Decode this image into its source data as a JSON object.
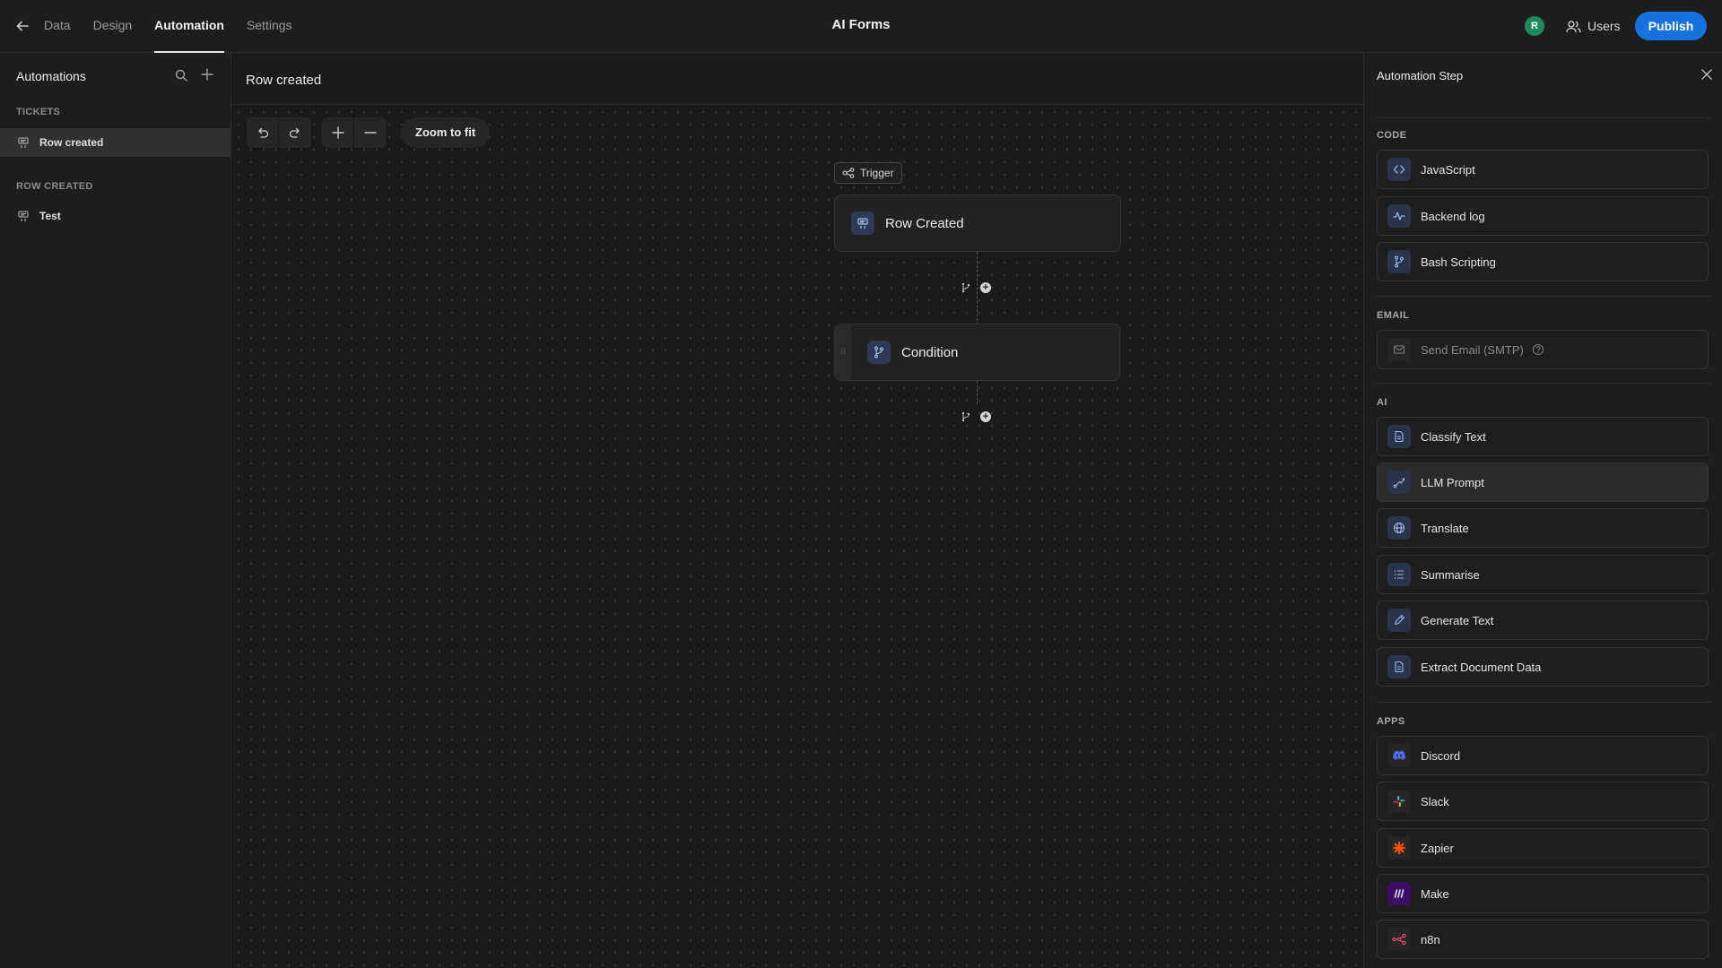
{
  "header": {
    "tabs": [
      {
        "label": "Data"
      },
      {
        "label": "Design"
      },
      {
        "label": "Automation"
      },
      {
        "label": "Settings"
      }
    ],
    "active_tab": "Automation",
    "app_title": "AI Forms",
    "avatar_initial": "R",
    "users_label": "Users",
    "publish_label": "Publish"
  },
  "sidebar": {
    "title": "Automations",
    "sections": [
      {
        "heading": "TICKETS",
        "items": [
          {
            "label": "Row created",
            "selected": true
          }
        ]
      },
      {
        "heading": "ROW CREATED",
        "items": [
          {
            "label": "Test",
            "selected": false
          }
        ]
      }
    ]
  },
  "canvas": {
    "title": "Row created",
    "zoom_to_fit_label": "Zoom to fit",
    "trigger_tag": "Trigger",
    "nodes": [
      {
        "label": "Row Created",
        "icon": "table-row-icon"
      },
      {
        "label": "Condition",
        "icon": "branch-icon"
      }
    ]
  },
  "panel": {
    "title": "Automation Step",
    "sections": [
      {
        "heading": "CODE",
        "items": [
          {
            "label": "JavaScript",
            "icon": "code-brackets-icon"
          },
          {
            "label": "Backend log",
            "icon": "activity-icon"
          },
          {
            "label": "Bash Scripting",
            "icon": "git-branch-icon"
          }
        ]
      },
      {
        "heading": "EMAIL",
        "items": [
          {
            "label": "Send Email (SMTP)",
            "icon": "mail-icon",
            "disabled": true
          }
        ]
      },
      {
        "heading": "AI",
        "items": [
          {
            "label": "Classify Text",
            "icon": "document-icon"
          },
          {
            "label": "LLM Prompt",
            "icon": "path-icon"
          },
          {
            "label": "Translate",
            "icon": "globe-icon"
          },
          {
            "label": "Summarise",
            "icon": "list-icon"
          },
          {
            "label": "Generate Text",
            "icon": "pencil-icon"
          },
          {
            "label": "Extract Document Data",
            "icon": "document-icon"
          }
        ]
      },
      {
        "heading": "APPS",
        "items": [
          {
            "label": "Discord",
            "icon": "discord-icon"
          },
          {
            "label": "Slack",
            "icon": "slack-icon"
          },
          {
            "label": "Zapier",
            "icon": "zapier-icon"
          },
          {
            "label": "Make",
            "icon": "make-icon"
          },
          {
            "label": "n8n",
            "icon": "n8n-icon"
          }
        ]
      }
    ]
  },
  "colors": {
    "accent": "#1573e0",
    "avatar": "#1c8c5e",
    "background": "#1a1a1a",
    "discord": "#5865f2",
    "zapier": "#ff4a00",
    "make": "#6d00cc",
    "n8n": "#ea4b71"
  }
}
